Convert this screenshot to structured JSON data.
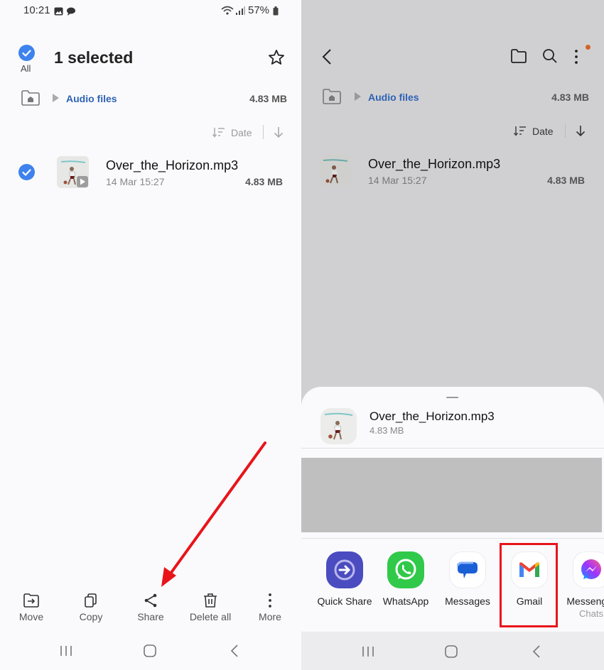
{
  "left_panel": {
    "status_bar": {
      "time": "10:21",
      "battery": "57%",
      "icons": [
        "gallery-icon",
        "chat-icon",
        "wifi-icon",
        "signal-icon",
        "battery-icon"
      ]
    },
    "header": {
      "select_all_label": "All",
      "title": "1 selected",
      "favorite_icon": "star-icon"
    },
    "breadcrumb": {
      "home_icon": "home-folder-icon",
      "folder": "Audio files",
      "size": "4.83 MB"
    },
    "sort": {
      "label": "Date",
      "direction_icon": "arrow-down-icon"
    },
    "files": [
      {
        "name": "Over_the_Horizon.mp3",
        "date": "14 Mar 15:27",
        "size": "4.83 MB",
        "selected": true
      }
    ],
    "actions": [
      {
        "label": "Move",
        "icon": "move-icon"
      },
      {
        "label": "Copy",
        "icon": "copy-icon"
      },
      {
        "label": "Share",
        "icon": "share-icon"
      },
      {
        "label": "Delete all",
        "icon": "trash-icon"
      },
      {
        "label": "More",
        "icon": "more-vertical-icon"
      }
    ],
    "annotation_color": "#e8141a"
  },
  "right_panel": {
    "toolbar": {
      "back_icon": "back-icon",
      "folder_icon": "folder-icon",
      "search_icon": "search-icon",
      "more_icon": "more-vertical-icon",
      "notification_dot_color": "#d4622a"
    },
    "breadcrumb": {
      "folder": "Audio files",
      "size": "4.83 MB"
    },
    "sort": {
      "label": "Date"
    },
    "files": [
      {
        "name": "Over_the_Horizon.mp3",
        "date": "14 Mar 15:27",
        "size": "4.83 MB"
      }
    ],
    "share_sheet": {
      "file_name": "Over_the_Horizon.mp3",
      "file_size": "4.83 MB",
      "apps": [
        {
          "label": "Quick Share",
          "icon": "quick-share-icon",
          "color": "#4a4cbf"
        },
        {
          "label": "WhatsApp",
          "icon": "whatsapp-icon",
          "color": "#30c94a"
        },
        {
          "label": "Messages",
          "icon": "messages-icon",
          "color": "#1a5fd6"
        },
        {
          "label": "Gmail",
          "icon": "gmail-icon",
          "highlighted": true
        },
        {
          "label": "Messenger",
          "sublabel": "Chats",
          "icon": "messenger-icon"
        }
      ],
      "highlight_color": "#e8141a"
    }
  },
  "nav_bar": {
    "items": [
      "recent-apps-icon",
      "home-icon",
      "back-icon"
    ]
  }
}
